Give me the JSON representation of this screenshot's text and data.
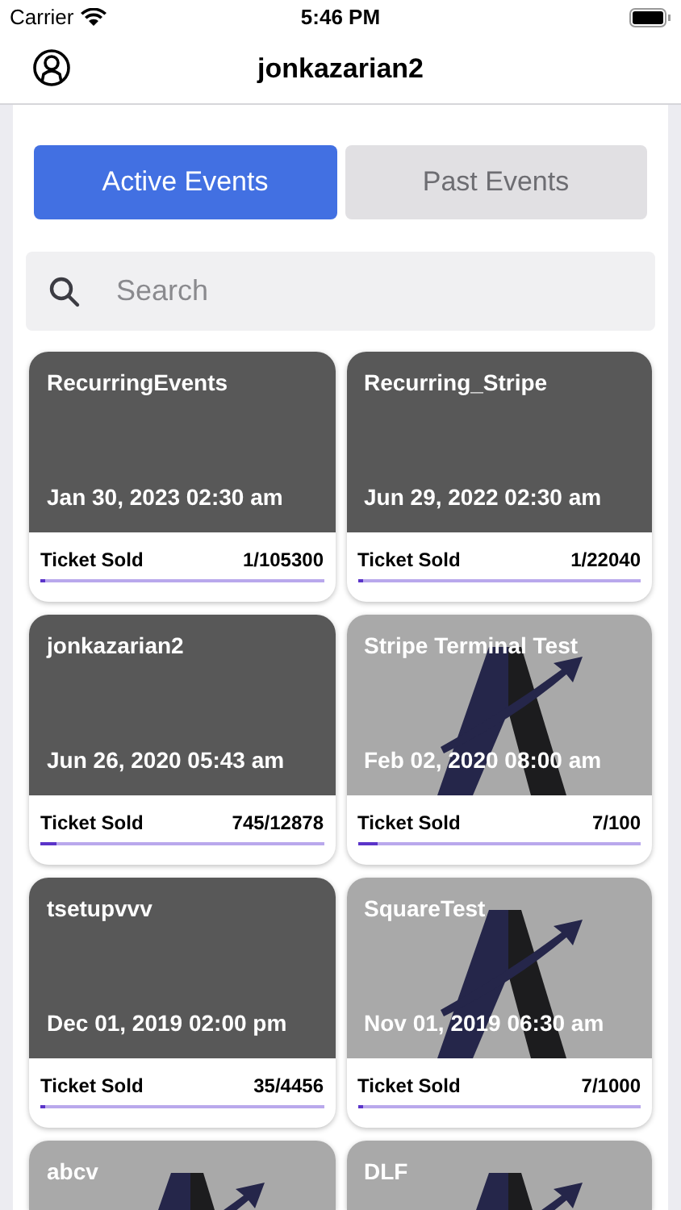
{
  "status_bar": {
    "carrier": "Carrier",
    "time": "5:46 PM"
  },
  "nav": {
    "title": "jonkazarian2"
  },
  "tabs": [
    {
      "label": "Active Events",
      "selected": true
    },
    {
      "label": "Past Events",
      "selected": false
    }
  ],
  "search": {
    "placeholder": "Search"
  },
  "events": [
    {
      "kind": "plain",
      "title": "RecurringEvents",
      "date": "Jan 30, 2023 02:30 am",
      "sold_label": "Ticket Sold",
      "sold": "1/105300",
      "level": 1e-05
    },
    {
      "kind": "plain",
      "title": "Recurring_Stripe",
      "date": "Jun 29, 2022 02:30 am",
      "sold_label": "Ticket Sold",
      "sold": "1/22040",
      "level": 5e-05
    },
    {
      "kind": "plain",
      "title": "jonkazarian2",
      "date": "Jun 26, 2020 05:43 am",
      "sold_label": "Ticket Sold",
      "sold": "745/12878",
      "level": 0.058
    },
    {
      "kind": "logo",
      "title": "Stripe Terminal Test",
      "date": "Feb 02, 2020 08:00 am",
      "sold_label": "Ticket Sold",
      "sold": "7/100",
      "level": 0.07
    },
    {
      "kind": "plain",
      "title": "tsetupvvv",
      "date": "Dec 01, 2019 02:00 pm",
      "sold_label": "Ticket Sold",
      "sold": "35/4456",
      "level": 0.008
    },
    {
      "kind": "logo",
      "title": "SquareTest",
      "date": "Nov 01, 2019 06:30 am",
      "sold_label": "Ticket Sold",
      "sold": "7/1000",
      "level": 0.007
    },
    {
      "kind": "logo",
      "title": "abcv"
    },
    {
      "kind": "logo",
      "title": "DLF"
    }
  ]
}
